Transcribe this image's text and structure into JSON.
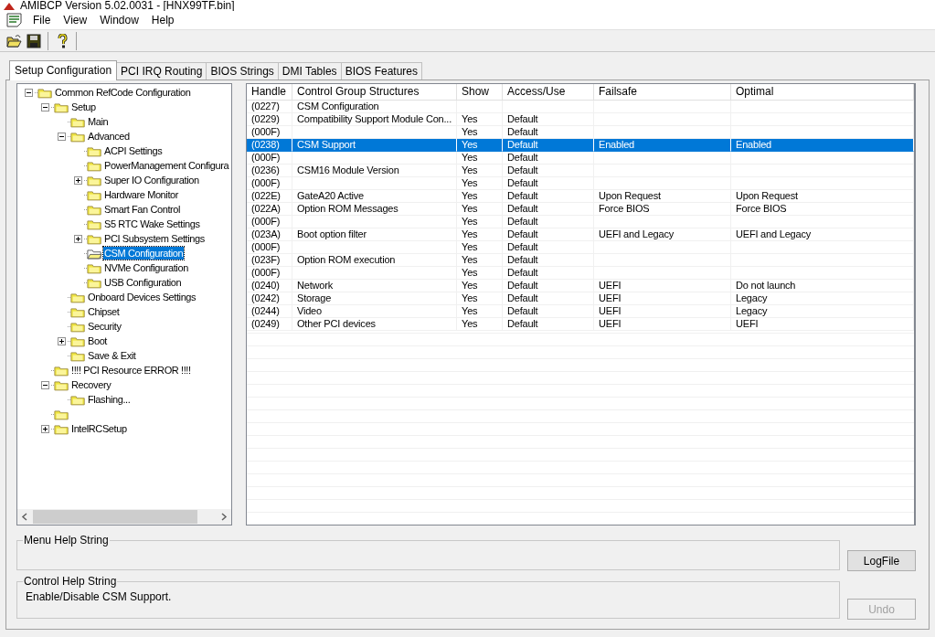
{
  "window": {
    "title": "AMIBCP Version 5.02.0031 - [HNX99TF.bin]"
  },
  "menu": [
    "File",
    "View",
    "Window",
    "Help"
  ],
  "toolbar": [
    {
      "kind": "open"
    },
    {
      "kind": "save"
    },
    {
      "kind": "help"
    }
  ],
  "tabs": [
    {
      "label": "Setup Configuration",
      "selected": true
    },
    {
      "label": "PCI IRQ Routing",
      "selected": false
    },
    {
      "label": "BIOS Strings",
      "selected": false
    },
    {
      "label": "DMI Tables",
      "selected": false
    },
    {
      "label": "BIOS Features",
      "selected": false
    }
  ],
  "tree": [
    {
      "label": "Common RefCode Configuration",
      "selected": false,
      "expanded": true,
      "children": [
        {
          "label": "Setup",
          "selected": false,
          "expanded": true,
          "children": [
            {
              "label": "Main",
              "selected": false
            },
            {
              "label": "Advanced",
              "selected": false,
              "expanded": true,
              "children": [
                {
                  "label": "ACPI Settings",
                  "selected": false
                },
                {
                  "label": "PowerManagement Configura",
                  "selected": false
                },
                {
                  "label": "Super IO Configuration",
                  "selected": false,
                  "expanded": false
                },
                {
                  "label": "Hardware Monitor",
                  "selected": false
                },
                {
                  "label": "Smart Fan Control",
                  "selected": false
                },
                {
                  "label": "S5 RTC Wake Settings",
                  "selected": false
                },
                {
                  "label": "PCI Subsystem Settings",
                  "selected": false,
                  "expanded": false
                },
                {
                  "label": "CSM Configuration",
                  "selected": true
                },
                {
                  "label": "NVMe Configuration",
                  "selected": false
                },
                {
                  "label": "USB Configuration",
                  "selected": false
                }
              ]
            },
            {
              "label": "Onboard Devices Settings",
              "selected": false
            },
            {
              "label": "Chipset",
              "selected": false
            },
            {
              "label": "Security",
              "selected": false
            },
            {
              "label": "Boot",
              "selected": false,
              "expanded": false
            },
            {
              "label": "Save & Exit",
              "selected": false
            }
          ]
        },
        {
          "label": "!!!! PCI Resource ERROR !!!!",
          "selected": false
        },
        {
          "label": "Recovery",
          "selected": false,
          "expanded": true,
          "children": [
            {
              "label": "Flashing...",
              "selected": false
            }
          ]
        },
        {
          "selected": false
        },
        {
          "label": "IntelRCSetup",
          "selected": false,
          "expanded": false
        }
      ]
    }
  ],
  "table": {
    "columns": [
      "Handle",
      "Control Group Structures",
      "Show",
      "Access/Use",
      "Failsafe",
      "Optimal"
    ],
    "rows": [
      {
        "cells": [
          "(0227)",
          "CSM Configuration",
          "",
          "",
          "",
          ""
        ],
        "selected": false
      },
      {
        "cells": [
          "(0229)",
          "Compatibility Support Module Con...",
          "Yes",
          "Default",
          "",
          ""
        ],
        "selected": false
      },
      {
        "cells": [
          "(000F)",
          "",
          "Yes",
          "Default",
          "",
          ""
        ],
        "selected": false
      },
      {
        "cells": [
          "(0238)",
          "CSM Support",
          "Yes",
          "Default",
          "Enabled",
          "Enabled"
        ],
        "selected": true
      },
      {
        "cells": [
          "(000F)",
          "",
          "Yes",
          "Default",
          "",
          ""
        ],
        "selected": false
      },
      {
        "cells": [
          "(0236)",
          "CSM16 Module Version",
          "Yes",
          "Default",
          "",
          ""
        ],
        "selected": false
      },
      {
        "cells": [
          "(000F)",
          "",
          "Yes",
          "Default",
          "",
          ""
        ],
        "selected": false
      },
      {
        "cells": [
          "(022E)",
          "GateA20 Active",
          "Yes",
          "Default",
          "Upon Request",
          "Upon Request"
        ],
        "selected": false
      },
      {
        "cells": [
          "(022A)",
          "Option ROM Messages",
          "Yes",
          "Default",
          "Force BIOS",
          "Force BIOS"
        ],
        "selected": false
      },
      {
        "cells": [
          "(000F)",
          "",
          "Yes",
          "Default",
          "",
          ""
        ],
        "selected": false
      },
      {
        "cells": [
          "(023A)",
          "Boot option filter",
          "Yes",
          "Default",
          "UEFI and Legacy",
          "UEFI and Legacy"
        ],
        "selected": false
      },
      {
        "cells": [
          "(000F)",
          "",
          "Yes",
          "Default",
          "",
          ""
        ],
        "selected": false
      },
      {
        "cells": [
          "(023F)",
          "Option ROM execution",
          "Yes",
          "Default",
          "",
          ""
        ],
        "selected": false
      },
      {
        "cells": [
          "(000F)",
          "",
          "Yes",
          "Default",
          "",
          ""
        ],
        "selected": false
      },
      {
        "cells": [
          "(0240)",
          "Network",
          "Yes",
          "Default",
          "UEFI",
          "Do not launch"
        ],
        "selected": false
      },
      {
        "cells": [
          "(0242)",
          "Storage",
          "Yes",
          "Default",
          "UEFI",
          "Legacy"
        ],
        "selected": false
      },
      {
        "cells": [
          "(0244)",
          "Video",
          "Yes",
          "Default",
          "UEFI",
          "Legacy"
        ],
        "selected": false
      },
      {
        "cells": [
          "(0249)",
          "Other PCI devices",
          "Yes",
          "Default",
          "UEFI",
          "UEFI"
        ],
        "selected": false
      }
    ]
  },
  "menu_help": {
    "title": "Menu Help String"
  },
  "control_help": {
    "title": "Control Help String",
    "text": "Enable/Disable CSM Support."
  },
  "buttons": [
    {
      "label": "LogFile",
      "disabled": false
    },
    {
      "label": "Undo",
      "disabled": true
    }
  ]
}
